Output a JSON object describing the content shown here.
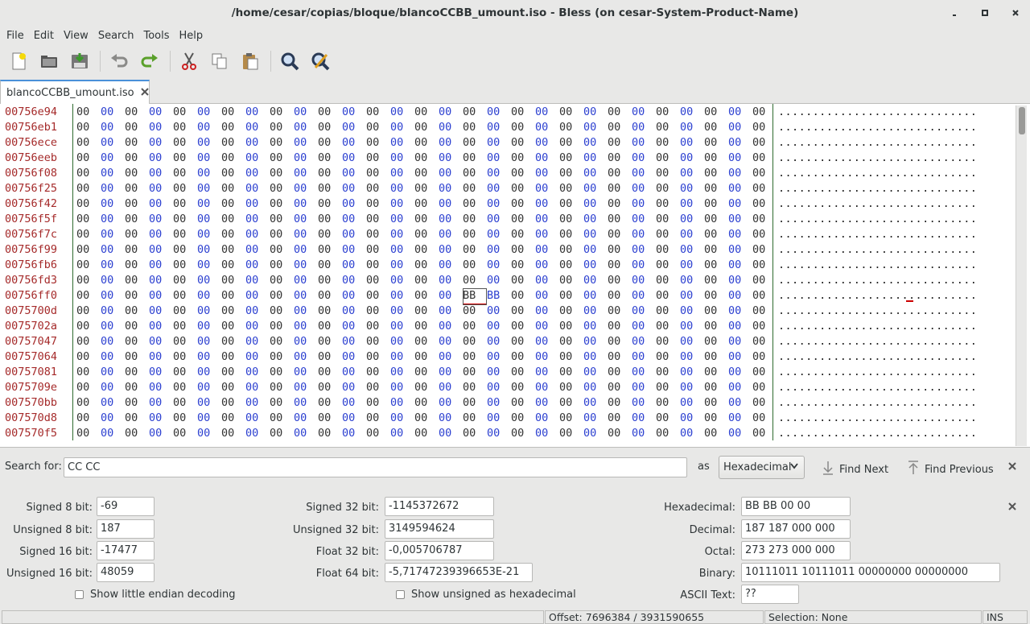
{
  "window": {
    "title": "/home/cesar/copias/bloque/blancoCCBB_umount.iso - Bless (on cesar-System-Product-Name)",
    "controls": [
      "minimize",
      "maximize",
      "close"
    ]
  },
  "menu": [
    "File",
    "Edit",
    "View",
    "Search",
    "Tools",
    "Help"
  ],
  "toolbar": [
    {
      "name": "new-file-icon"
    },
    {
      "name": "open-folder-icon"
    },
    {
      "name": "save-icon"
    },
    {
      "name": "undo-icon"
    },
    {
      "name": "redo-icon"
    },
    {
      "name": "cut-icon"
    },
    {
      "name": "copy-icon"
    },
    {
      "name": "paste-icon"
    },
    {
      "name": "find-icon"
    },
    {
      "name": "find-replace-icon"
    }
  ],
  "tab": {
    "label": "blancoCCBB_umount.iso"
  },
  "hex": {
    "offsets": [
      "00756e94",
      "00756eb1",
      "00756ece",
      "00756eeb",
      "00756f08",
      "00756f25",
      "00756f42",
      "00756f5f",
      "00756f7c",
      "00756f99",
      "00756fb6",
      "00756fd3",
      "00756ff0",
      "0075700d",
      "0075702a",
      "00757047",
      "00757064",
      "00757081",
      "0075709e",
      "007570bb",
      "007570d8",
      "007570f5"
    ],
    "bytes_per_row": 29,
    "fill_byte": "00",
    "highlight_row": 12,
    "highlight_bytes": [
      {
        "col": 16,
        "value": "BB"
      },
      {
        "col": 17,
        "value": "BB"
      }
    ],
    "ascii_row": "............................."
  },
  "search": {
    "label": "Search for:",
    "value": "CC CC",
    "as_label": "as",
    "mode": "Hexadecimal",
    "find_next": "Find Next",
    "find_previous": "Find Previous"
  },
  "conversion": {
    "signed8_label": "Signed 8 bit:",
    "signed8": "-69",
    "unsigned8_label": "Unsigned 8 bit:",
    "unsigned8": "187",
    "signed16_label": "Signed 16 bit:",
    "signed16": "-17477",
    "unsigned16_label": "Unsigned 16 bit:",
    "unsigned16": "48059",
    "signed32_label": "Signed 32 bit:",
    "signed32": "-1145372672",
    "unsigned32_label": "Unsigned 32 bit:",
    "unsigned32": "3149594624",
    "float32_label": "Float 32 bit:",
    "float32": "-0,005706787",
    "float64_label": "Float 64 bit:",
    "float64": "-5,71747239396653E-21",
    "hex_label": "Hexadecimal:",
    "hex": "BB BB 00 00",
    "dec_label": "Decimal:",
    "dec": "187 187 000 000",
    "oct_label": "Octal:",
    "oct": "273 273 000 000",
    "bin_label": "Binary:",
    "bin": "10111011 10111011 00000000 00000000",
    "ascii_label": "ASCII Text:",
    "ascii": "??",
    "little_endian": "Show little endian decoding",
    "unsigned_hex": "Show unsigned as hexadecimal"
  },
  "status": {
    "offset": "Offset: 7696384 / 3931590655",
    "selection": "Selection: None",
    "mode": "INS"
  }
}
